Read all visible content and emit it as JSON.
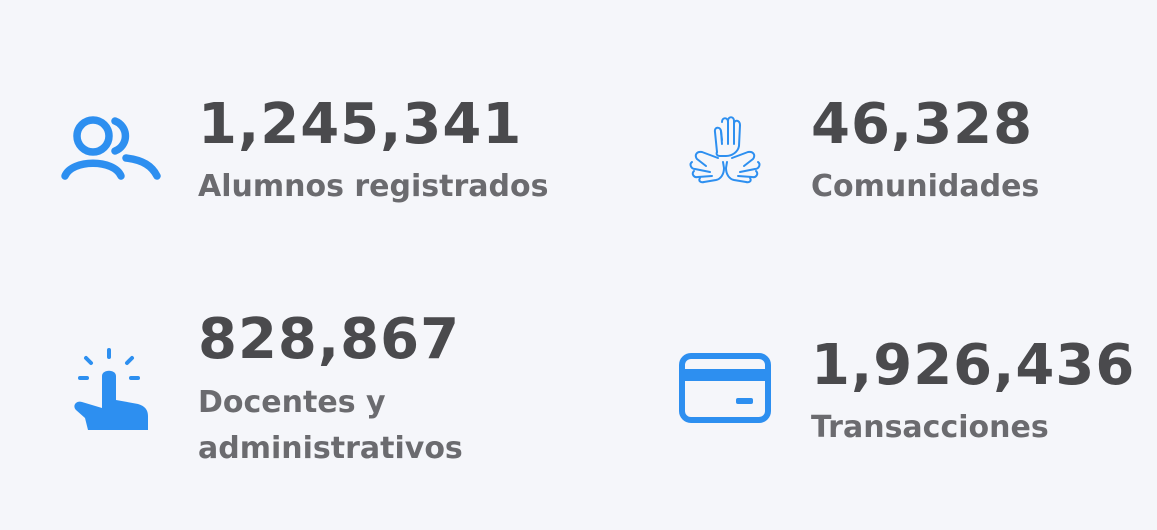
{
  "colors": {
    "background": "#f5f6fa",
    "icon_blue": "#2d8ff0",
    "value_text": "#4a4a4d",
    "label_text": "#6b6b6f"
  },
  "stats": [
    {
      "icon": "users-icon",
      "value": "1,245,341",
      "label_lines": [
        "Alumnos registrados"
      ]
    },
    {
      "icon": "hands-together-icon",
      "value": "46,328",
      "label_lines": [
        "Comunidades"
      ]
    },
    {
      "icon": "pointer-tap-icon",
      "value": "828,867",
      "label_lines": [
        "Docentes y",
        "administrativos"
      ]
    },
    {
      "icon": "credit-card-icon",
      "value": "1,926,436",
      "label_lines": [
        "Transacciones"
      ]
    }
  ]
}
